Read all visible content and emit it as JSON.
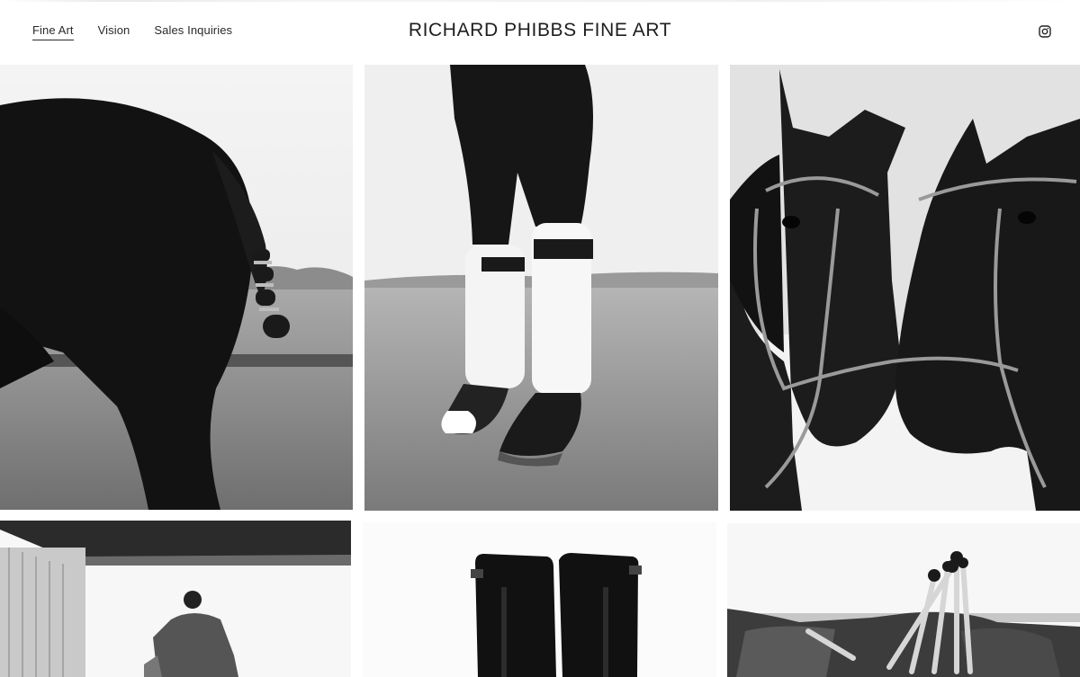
{
  "site": {
    "title": "RICHARD PHIBBS FINE ART"
  },
  "nav": {
    "items": [
      {
        "label": "Fine Art",
        "active": true
      },
      {
        "label": "Vision",
        "active": false
      },
      {
        "label": "Sales Inquiries",
        "active": false
      }
    ]
  },
  "social": {
    "icon": "instagram-icon"
  },
  "gallery": {
    "tiles": [
      {
        "subject": "horse-hindquarters-photo"
      },
      {
        "subject": "bandaged-horse-legs-photo"
      },
      {
        "subject": "two-horses-heads-photo"
      },
      {
        "subject": "stable-rider-photo"
      },
      {
        "subject": "riding-boots-photo"
      },
      {
        "subject": "polo-mallets-photo"
      }
    ]
  }
}
